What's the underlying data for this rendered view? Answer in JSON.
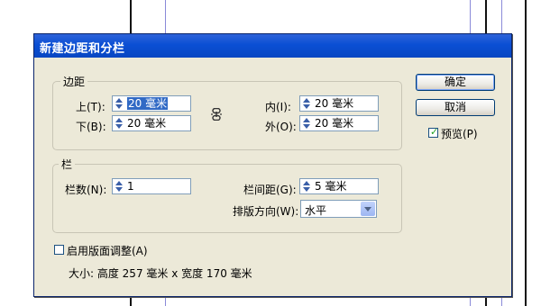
{
  "dialog": {
    "title": "新建边距和分栏",
    "margins": {
      "group_label": "边距",
      "top_label": "上(T):",
      "top_value": "20 毫米",
      "bottom_label": "下(B):",
      "bottom_value": "20 毫米",
      "inside_label": "内(I):",
      "inside_value": "20 毫米",
      "outside_label": "外(O):",
      "outside_value": "20 毫米",
      "link_icon": "chain-link-icon"
    },
    "columns": {
      "group_label": "栏",
      "number_label": "栏数(N):",
      "number_value": "1",
      "gutter_label": "栏间距(G):",
      "gutter_value": "5 毫米",
      "direction_label": "排版方向(W):",
      "direction_value": "水平"
    },
    "layout_adjust_label": "启用版面调整(A)",
    "layout_adjust_checked": false,
    "size_text": "大小: 高度 257 毫米 x 宽度 170 毫米",
    "buttons": {
      "ok": "确定",
      "cancel": "取消"
    },
    "preview_label": "预览(P)",
    "preview_checked": true
  },
  "colors": {
    "titlebar": "#0a4fd4",
    "dialog_bg": "#ece9d8",
    "selection": "#316ac5"
  }
}
